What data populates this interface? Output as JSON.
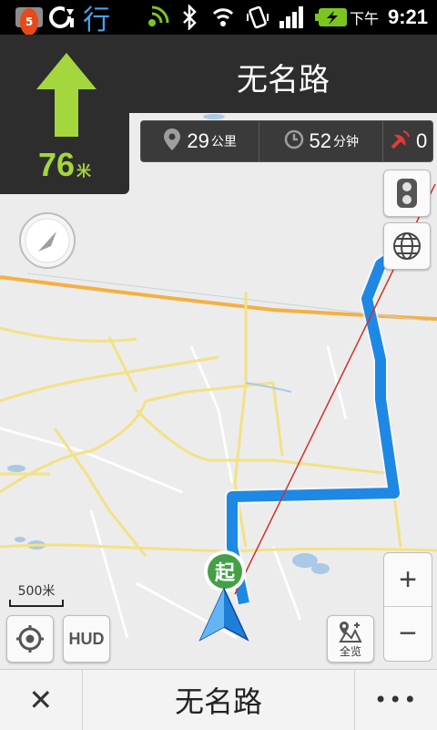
{
  "status_bar": {
    "notification_count": "5",
    "app_icon_char": "行",
    "ampm": "下午",
    "time": "9:21",
    "battery_color": "#7cc51f"
  },
  "guidance": {
    "turn_icon": "arrow-up-icon",
    "distance_value": "76",
    "distance_unit": "米",
    "arrow_color": "#a4d63e"
  },
  "road": {
    "current_name": "无名路"
  },
  "trip_info": {
    "distance_value": "29",
    "distance_unit": "公里",
    "time_value": "52",
    "time_unit": "分钟",
    "camera_count": "0"
  },
  "map": {
    "start_marker_label": "起",
    "scale_label": "500米",
    "route_color": "#1e88e5"
  },
  "controls": {
    "hud_label": "HUD",
    "overview_label": "全览",
    "zoom_in_label": "+",
    "zoom_out_label": "−"
  },
  "bottom_bar": {
    "close_label": "✕",
    "road_name": "无名路",
    "more_label": "•••"
  }
}
